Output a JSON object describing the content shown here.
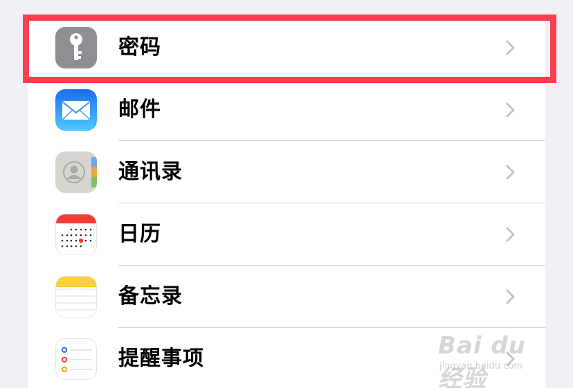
{
  "settings_list": {
    "items": [
      {
        "label": "密码",
        "icon": "key-icon",
        "color": "#8e8e93"
      },
      {
        "label": "邮件",
        "icon": "mail-icon",
        "color": "#1e8cf5"
      },
      {
        "label": "通讯录",
        "icon": "contacts-icon",
        "color": "#c9c9c4"
      },
      {
        "label": "日历",
        "icon": "calendar-icon",
        "color": "#f53b36"
      },
      {
        "label": "备忘录",
        "icon": "notes-icon",
        "color": "#fcd13a"
      },
      {
        "label": "提醒事项",
        "icon": "reminders-icon",
        "color": "#ffffff"
      }
    ]
  },
  "highlight": {
    "color": "#fa3f4f",
    "target": "密码"
  },
  "watermark": {
    "brand": "Bai du 经验",
    "sub": "jingyan.baidu.com"
  }
}
